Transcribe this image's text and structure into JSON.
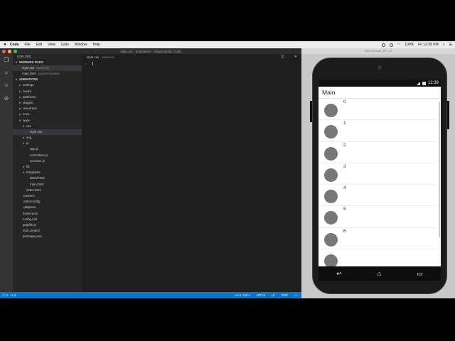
{
  "menubar": {
    "apple": "",
    "items": [
      "Code",
      "File",
      "Edit",
      "View",
      "Goto",
      "Window",
      "Help"
    ],
    "battery": "100%",
    "clock": "Fri 12:39 PM"
  },
  "window": {
    "title": "style.css - animations - Visual Studio Code"
  },
  "sidebar": {
    "explore_title": "EXPLORE",
    "working_files_header": "WORKING FILES",
    "working_files": [
      {
        "name": "style.css",
        "desc": "www/css"
      },
      {
        "name": "main.html",
        "desc": "www/templates"
      }
    ],
    "project_header": "ANIMATIONS",
    "tree": [
      {
        "label": "settings",
        "depth": 1,
        "type": "folder"
      },
      {
        "label": "hooks",
        "depth": 1,
        "type": "folder"
      },
      {
        "label": "platforms",
        "depth": 1,
        "type": "folder"
      },
      {
        "label": "plugins",
        "depth": 1,
        "type": "folder"
      },
      {
        "label": "resources",
        "depth": 1,
        "type": "folder"
      },
      {
        "label": "scss",
        "depth": 1,
        "type": "folder"
      },
      {
        "label": "www",
        "depth": 1,
        "type": "folder-open"
      },
      {
        "label": "css",
        "depth": 2,
        "type": "folder-open"
      },
      {
        "label": "style.css",
        "depth": 3,
        "type": "file",
        "selected": true
      },
      {
        "label": "img",
        "depth": 2,
        "type": "folder"
      },
      {
        "label": "js",
        "depth": 2,
        "type": "folder-open"
      },
      {
        "label": "app.js",
        "depth": 3,
        "type": "file"
      },
      {
        "label": "controllers.js",
        "depth": 3,
        "type": "file"
      },
      {
        "label": "services.js",
        "depth": 3,
        "type": "file"
      },
      {
        "label": "lib",
        "depth": 2,
        "type": "folder"
      },
      {
        "label": "templates",
        "depth": 2,
        "type": "folder-open"
      },
      {
        "label": "detail.html",
        "depth": 3,
        "type": "file"
      },
      {
        "label": "main.html",
        "depth": 3,
        "type": "file"
      },
      {
        "label": "index.html",
        "depth": 2,
        "type": "file"
      },
      {
        "label": ".bowerrc",
        "depth": 1,
        "type": "file"
      },
      {
        "label": ".editorconfig",
        "depth": 1,
        "type": "file"
      },
      {
        "label": ".gitignore",
        "depth": 1,
        "type": "file"
      },
      {
        "label": "bower.json",
        "depth": 1,
        "type": "file"
      },
      {
        "label": "config.xml",
        "depth": 1,
        "type": "file"
      },
      {
        "label": "gulpfile.js",
        "depth": 1,
        "type": "file"
      },
      {
        "label": "ionic.project",
        "depth": 1,
        "type": "file"
      },
      {
        "label": "package.json",
        "depth": 1,
        "type": "file"
      }
    ]
  },
  "editor": {
    "tab_name": "style.css",
    "tab_desc": "www/css",
    "line_number": "1"
  },
  "statusbar": {
    "left_icons": [
      "ⓧ 0",
      "⚠ 0"
    ],
    "ln_col": "Ln 1, Col 1",
    "encoding": "UTF-8",
    "eol": "LF",
    "language": "CSS",
    "feedback": "☺"
  },
  "emulator": {
    "title": "5554:Nexus5_API_22",
    "clock": "12:39",
    "app_title": "Main",
    "items": [
      "0",
      "1",
      "2",
      "3",
      "4",
      "5",
      "6"
    ]
  }
}
